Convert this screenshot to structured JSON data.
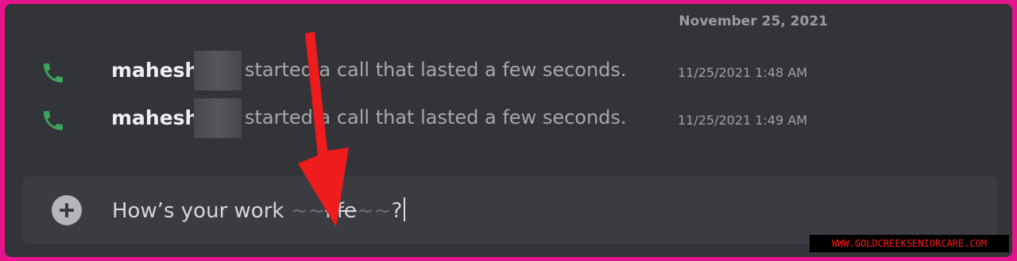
{
  "chat": {
    "date_divider": "November 25, 2021",
    "messages": [
      {
        "author": "mahesh",
        "action": "started a call that lasted a few seconds.",
        "timestamp": "11/25/2021 1:48 AM",
        "icon": "phone-icon"
      },
      {
        "author": "mahesh",
        "action": "started a call that lasted a few seconds.",
        "timestamp": "11/25/2021 1:49 AM",
        "icon": "phone-icon"
      }
    ]
  },
  "composer": {
    "text_before": "How’s your work ",
    "dash1": "~~",
    "strike_word": "life",
    "dash2": "~~",
    "text_after": "?",
    "add_icon": "plus-circle-icon"
  },
  "watermark": "WWW.GOLDCREEKSENIORCARE.COM",
  "colors": {
    "page_border": "#e6138c",
    "background": "#333438",
    "phone_green": "#3ba55d",
    "arrow_red": "#ee1c1c"
  }
}
